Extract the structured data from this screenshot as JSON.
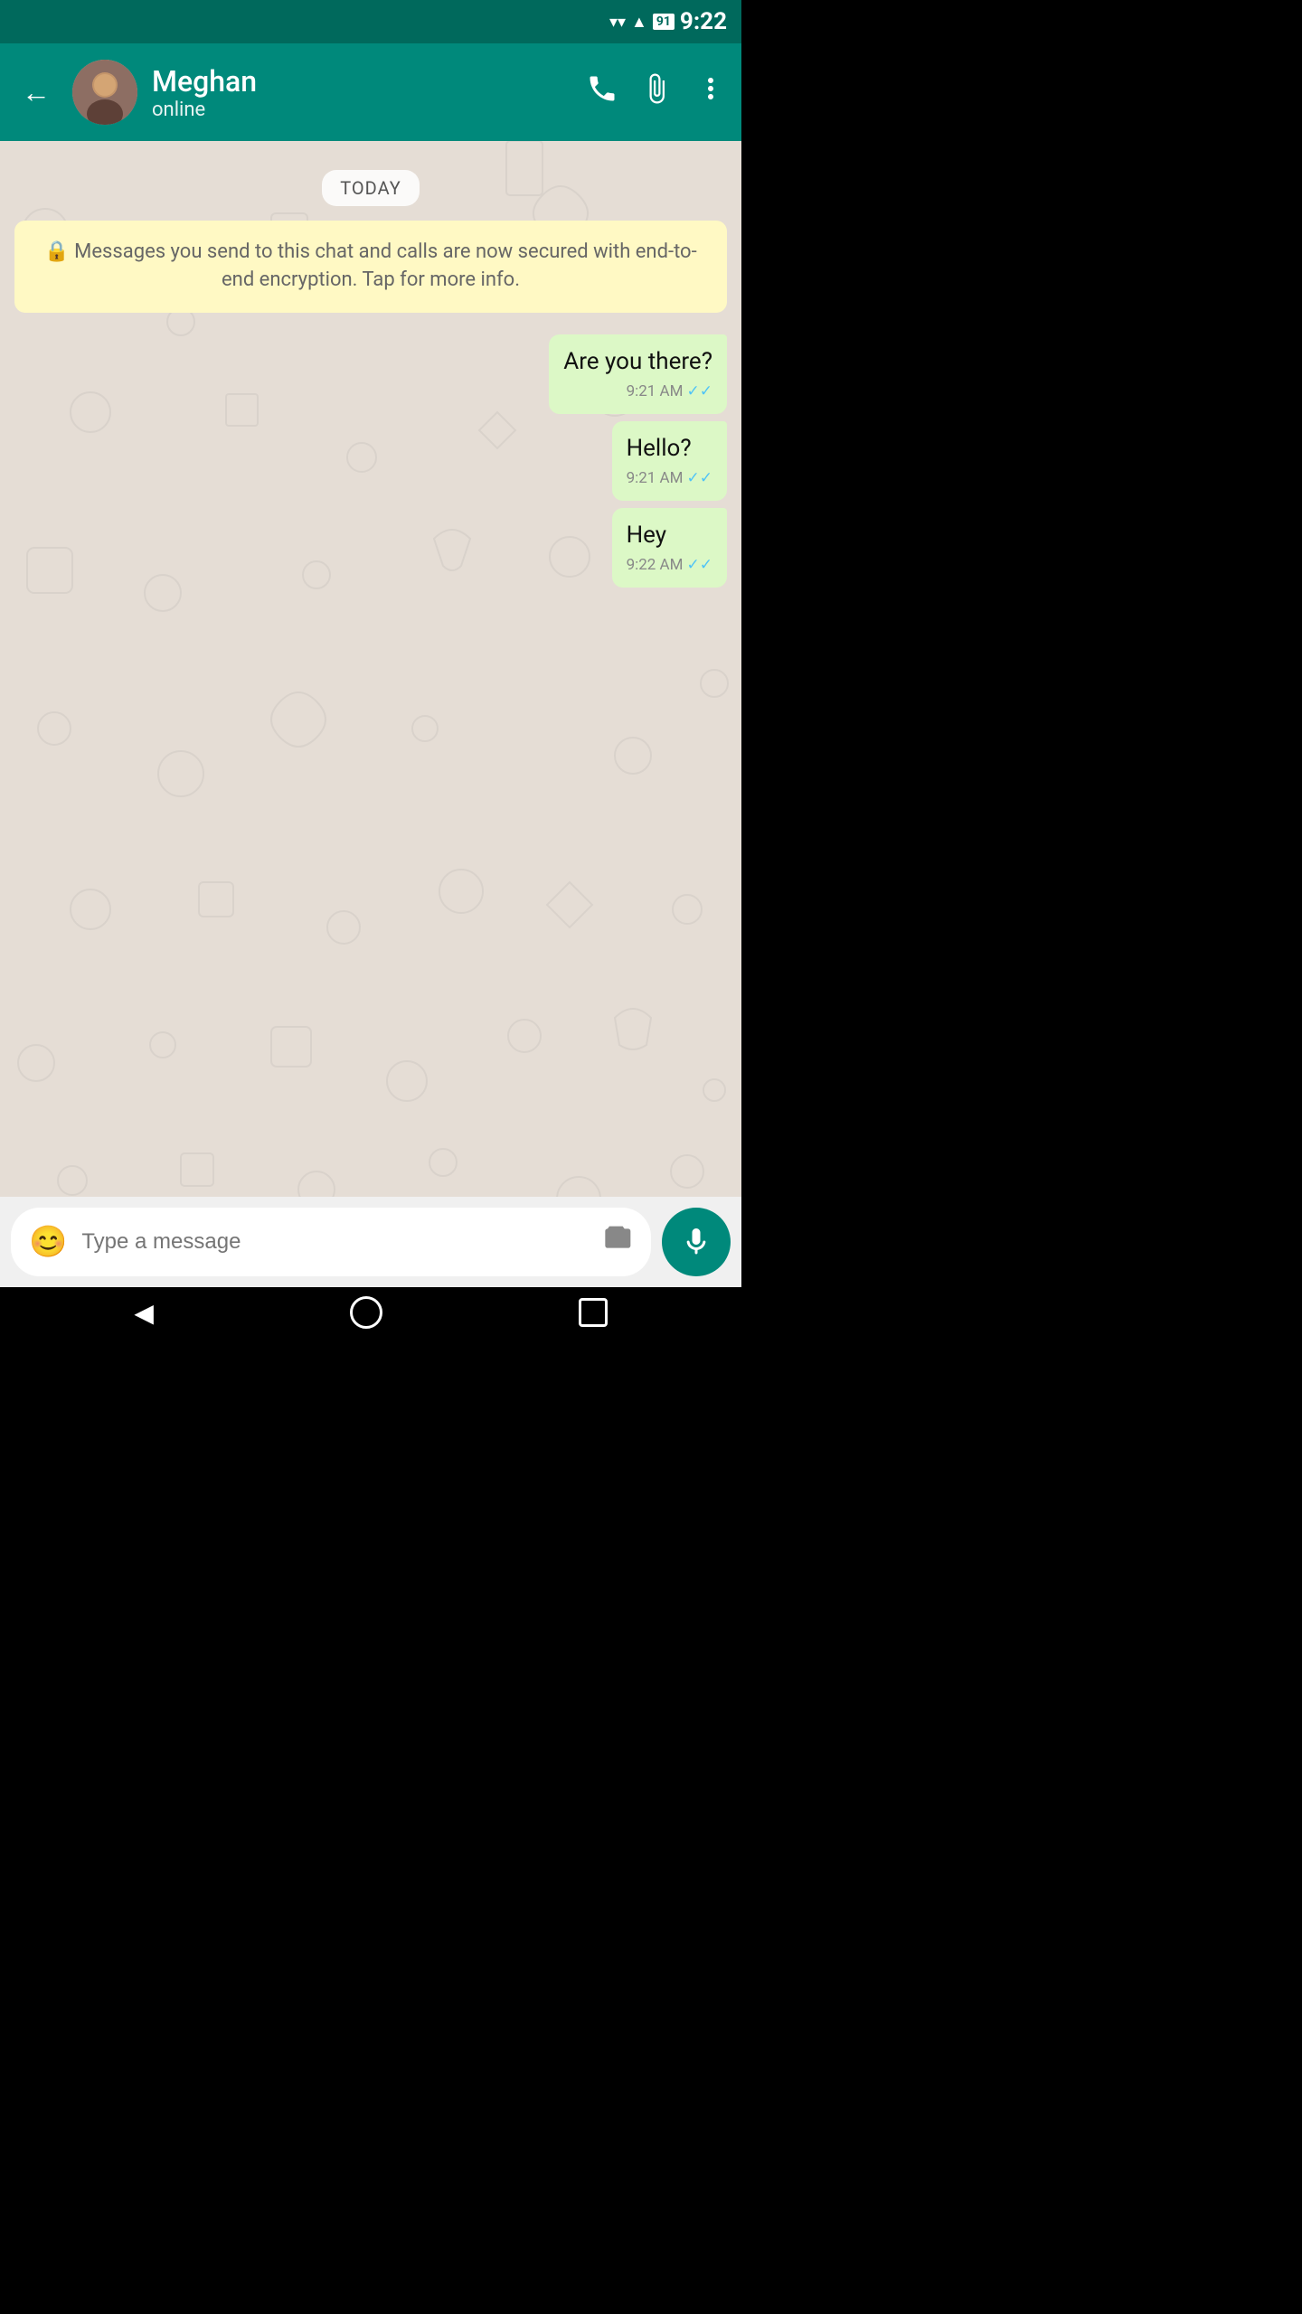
{
  "statusBar": {
    "time": "9:22",
    "batteryLevel": "91"
  },
  "header": {
    "backLabel": "←",
    "contactName": "Meghan",
    "contactStatus": "online",
    "callIcon": "📞",
    "attachIcon": "📎",
    "moreIcon": "⋮"
  },
  "chat": {
    "dateBadge": "TODAY",
    "encryptionNotice": "🔒 Messages you send to this chat and calls are now secured with end-to-end encryption. Tap for more info.",
    "messages": [
      {
        "id": 1,
        "text": "Are you there?",
        "time": "9:21 AM",
        "type": "sent",
        "ticks": "✓✓"
      },
      {
        "id": 2,
        "text": "Hello?",
        "time": "9:21 AM",
        "type": "sent",
        "ticks": "✓✓"
      },
      {
        "id": 3,
        "text": "Hey",
        "time": "9:22 AM",
        "type": "sent",
        "ticks": "✓✓"
      }
    ]
  },
  "inputArea": {
    "placeholder": "Type a message",
    "emojiIcon": "😊",
    "cameraIcon": "📷",
    "micIcon": "🎤"
  },
  "navBar": {
    "backIcon": "◀",
    "homeIcon": "○",
    "squareIcon": "□"
  }
}
